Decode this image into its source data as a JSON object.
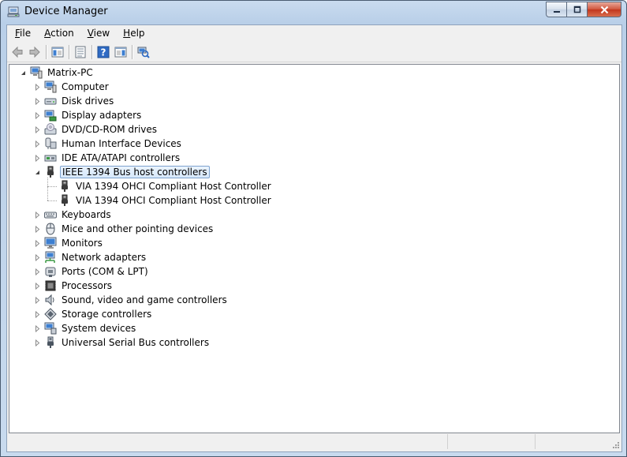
{
  "window": {
    "title": "Device Manager"
  },
  "menubar": [
    {
      "label": "File",
      "accel": "F",
      "rest": "ile"
    },
    {
      "label": "Action",
      "accel": "A",
      "rest": "ction"
    },
    {
      "label": "View",
      "accel": "V",
      "rest": "iew"
    },
    {
      "label": "Help",
      "accel": "H",
      "rest": "elp"
    }
  ],
  "toolbar": [
    {
      "name": "back-button",
      "icon": "arrow-left-icon"
    },
    {
      "name": "forward-button",
      "icon": "arrow-right-icon"
    },
    {
      "sep": true
    },
    {
      "name": "show-hide-console-tree-button",
      "icon": "console-tree-icon"
    },
    {
      "sep": true
    },
    {
      "name": "properties-button",
      "icon": "properties-icon"
    },
    {
      "sep": true
    },
    {
      "name": "help-button",
      "icon": "help-icon"
    },
    {
      "name": "show-action-pane-button",
      "icon": "action-pane-icon"
    },
    {
      "sep": true
    },
    {
      "name": "scan-hardware-changes-button",
      "icon": "scan-hardware-icon"
    }
  ],
  "tree": {
    "root": {
      "label": "Matrix-PC",
      "icon": "computer-icon",
      "expanded": true
    },
    "categories": [
      {
        "label": "Computer",
        "icon": "computer-icon"
      },
      {
        "label": "Disk drives",
        "icon": "disk-drive-icon"
      },
      {
        "label": "Display adapters",
        "icon": "display-adapter-icon"
      },
      {
        "label": "DVD/CD-ROM drives",
        "icon": "dvd-drive-icon"
      },
      {
        "label": "Human Interface Devices",
        "icon": "hid-icon"
      },
      {
        "label": "IDE ATA/ATAPI controllers",
        "icon": "ide-controller-icon"
      },
      {
        "label": "IEEE 1394 Bus host controllers",
        "icon": "firewire-icon",
        "expanded": true,
        "selected": true,
        "children": [
          {
            "label": "VIA 1394 OHCI Compliant Host Controller",
            "icon": "firewire-icon"
          },
          {
            "label": "VIA 1394 OHCI Compliant Host Controller",
            "icon": "firewire-icon"
          }
        ]
      },
      {
        "label": "Keyboards",
        "icon": "keyboard-icon"
      },
      {
        "label": "Mice and other pointing devices",
        "icon": "mouse-icon"
      },
      {
        "label": "Monitors",
        "icon": "monitor-icon"
      },
      {
        "label": "Network adapters",
        "icon": "network-adapter-icon"
      },
      {
        "label": "Ports (COM & LPT)",
        "icon": "port-icon"
      },
      {
        "label": "Processors",
        "icon": "processor-icon"
      },
      {
        "label": "Sound, video and game controllers",
        "icon": "speaker-icon"
      },
      {
        "label": "Storage controllers",
        "icon": "storage-controller-icon"
      },
      {
        "label": "System devices",
        "icon": "system-devices-icon"
      },
      {
        "label": "Universal Serial Bus controllers",
        "icon": "usb-icon"
      }
    ]
  },
  "status": {
    "panes": [
      "",
      "",
      ""
    ]
  }
}
